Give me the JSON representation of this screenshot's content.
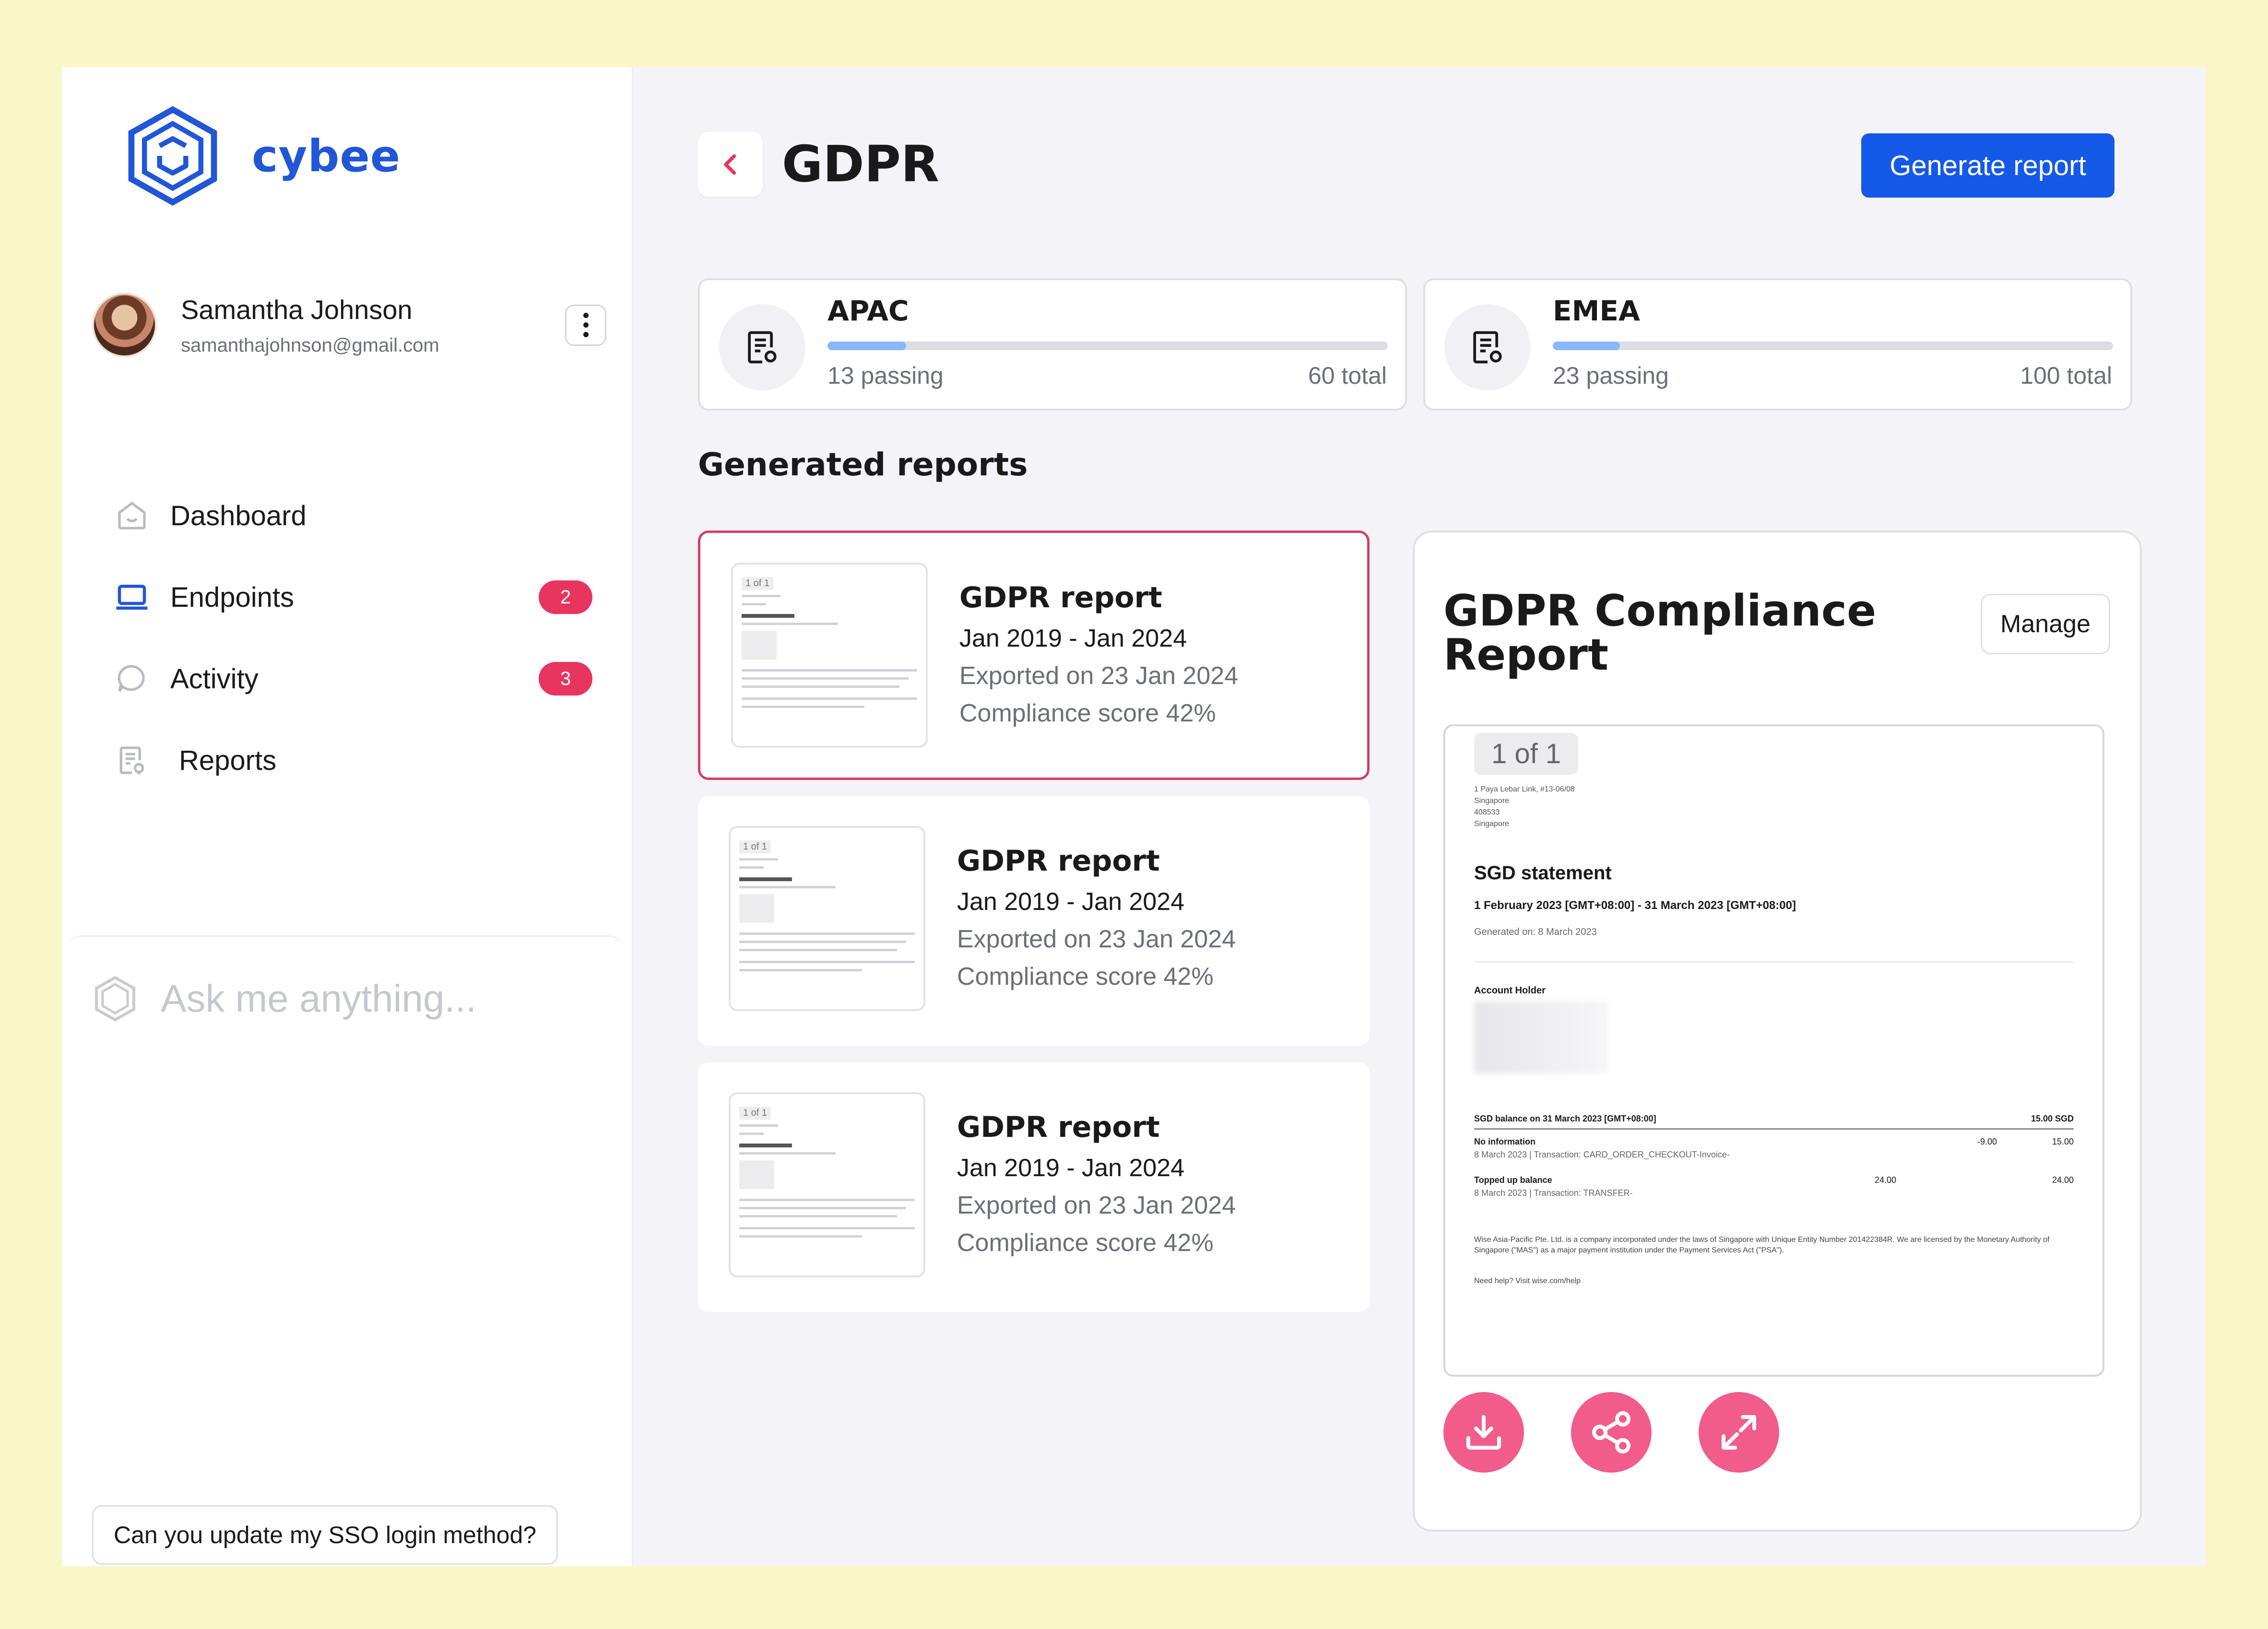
{
  "brand": {
    "name": "cybee",
    "accent": "#2156d9"
  },
  "user": {
    "name": "Samantha Johnson",
    "email": "samanthajohnson@gmail.com",
    "menu_icon": "kebab-menu-icon"
  },
  "nav": {
    "items": [
      {
        "label": "Dashboard",
        "icon": "home-icon",
        "badge": null
      },
      {
        "label": "Endpoints",
        "icon": "laptop-icon",
        "badge": "2"
      },
      {
        "label": "Activity",
        "icon": "chat-bubble-icon",
        "badge": "3"
      },
      {
        "label": "Reports",
        "icon": "report-icon",
        "badge": null
      }
    ]
  },
  "assistant": {
    "placeholder": "Ask me anything...",
    "suggestion": "Can you update my SSO login method?"
  },
  "page": {
    "title": "GDPR",
    "generate_label": "Generate report",
    "back_icon": "chevron-left-icon"
  },
  "regions": [
    {
      "name": "APAC",
      "passing": "13 passing",
      "total": "60 total",
      "progress": 0.14
    },
    {
      "name": "EMEA",
      "passing": "23 passing",
      "total": "100 total",
      "progress": 0.12
    }
  ],
  "reports_section": {
    "title": "Generated reports",
    "items": [
      {
        "title": "GDPR report",
        "range": "Jan 2019 - Jan 2024",
        "exported": "Exported on 23 Jan 2024",
        "score": "Compliance score 42%",
        "selected": true
      },
      {
        "title": "GDPR report",
        "range": "Jan 2019 - Jan 2024",
        "exported": "Exported on 23 Jan 2024",
        "score": "Compliance score 42%",
        "selected": false
      },
      {
        "title": "GDPR report",
        "range": "Jan 2019 - Jan 2024",
        "exported": "Exported on 23 Jan 2024",
        "score": "Compliance score 42%",
        "selected": false
      }
    ]
  },
  "preview": {
    "title": "GDPR Compliance Report",
    "manage_label": "Manage",
    "doc": {
      "page_indicator": "1 of 1",
      "address": [
        "1 Paya Lebar Link, #13-06/08",
        "Singapore",
        "408533",
        "Singapore"
      ],
      "heading": "SGD statement",
      "period": "1 February 2023 [GMT+08:00] - 31 March 2023 [GMT+08:00]",
      "generated": "Generated on: 8 March 2023",
      "holder_label": "Account Holder",
      "balance_label": "SGD balance on 31 March 2023 [GMT+08:00]",
      "balance_value": "15.00 SGD",
      "rows": [
        {
          "title": "No information",
          "sub": "8 March 2023 | Transaction: CARD_ORDER_CHECKOUT-Invoice-",
          "amount": "-9.00",
          "balance": "15.00"
        },
        {
          "title": "Topped up balance",
          "sub": "8 March 2023 | Transaction: TRANSFER-",
          "amount": "24.00",
          "balance": "24.00"
        }
      ],
      "footer": "Wise Asia-Pacific Pte. Ltd. is a company incorporated under the laws of Singapore with Unique Entity Number 201422384R. We are licensed by the Monetary Authority of Singapore (\"MAS\") as a major payment institution under the Payment Services Act (\"PSA\").",
      "help": "Need help? Visit wise.com/help"
    },
    "actions": [
      {
        "icon": "download-icon"
      },
      {
        "icon": "share-icon"
      },
      {
        "icon": "expand-icon"
      }
    ],
    "action_color": "#f25c8b"
  }
}
